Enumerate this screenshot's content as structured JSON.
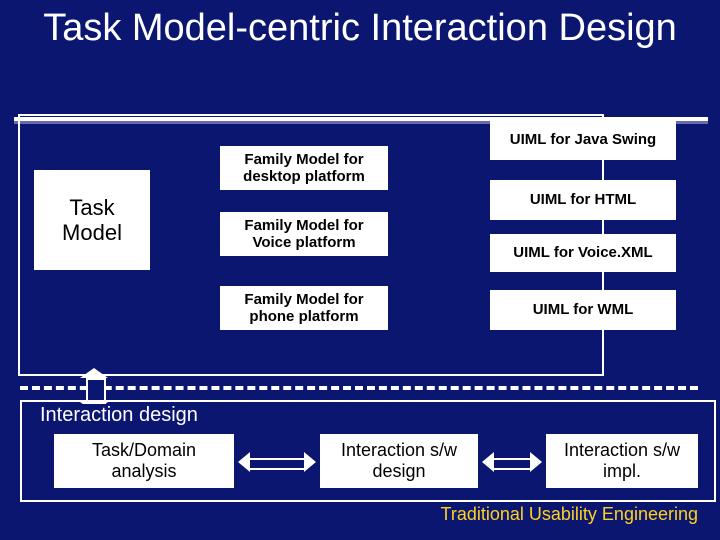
{
  "title": "Task Model-centric Interaction Design",
  "upper": {
    "task_model": "Task Model",
    "family": [
      "Family Model for desktop platform",
      "Family Model for Voice platform",
      "Family Model for phone platform"
    ],
    "uiml": [
      "UIML for Java Swing",
      "UIML for HTML",
      "UIML for Voice.XML",
      "UIML for WML"
    ]
  },
  "lower": {
    "label": "Interaction design",
    "steps": [
      "Task/Domain analysis",
      "Interaction s/w design",
      "Interaction s/w impl."
    ]
  },
  "footer": "Traditional Usability Engineering"
}
